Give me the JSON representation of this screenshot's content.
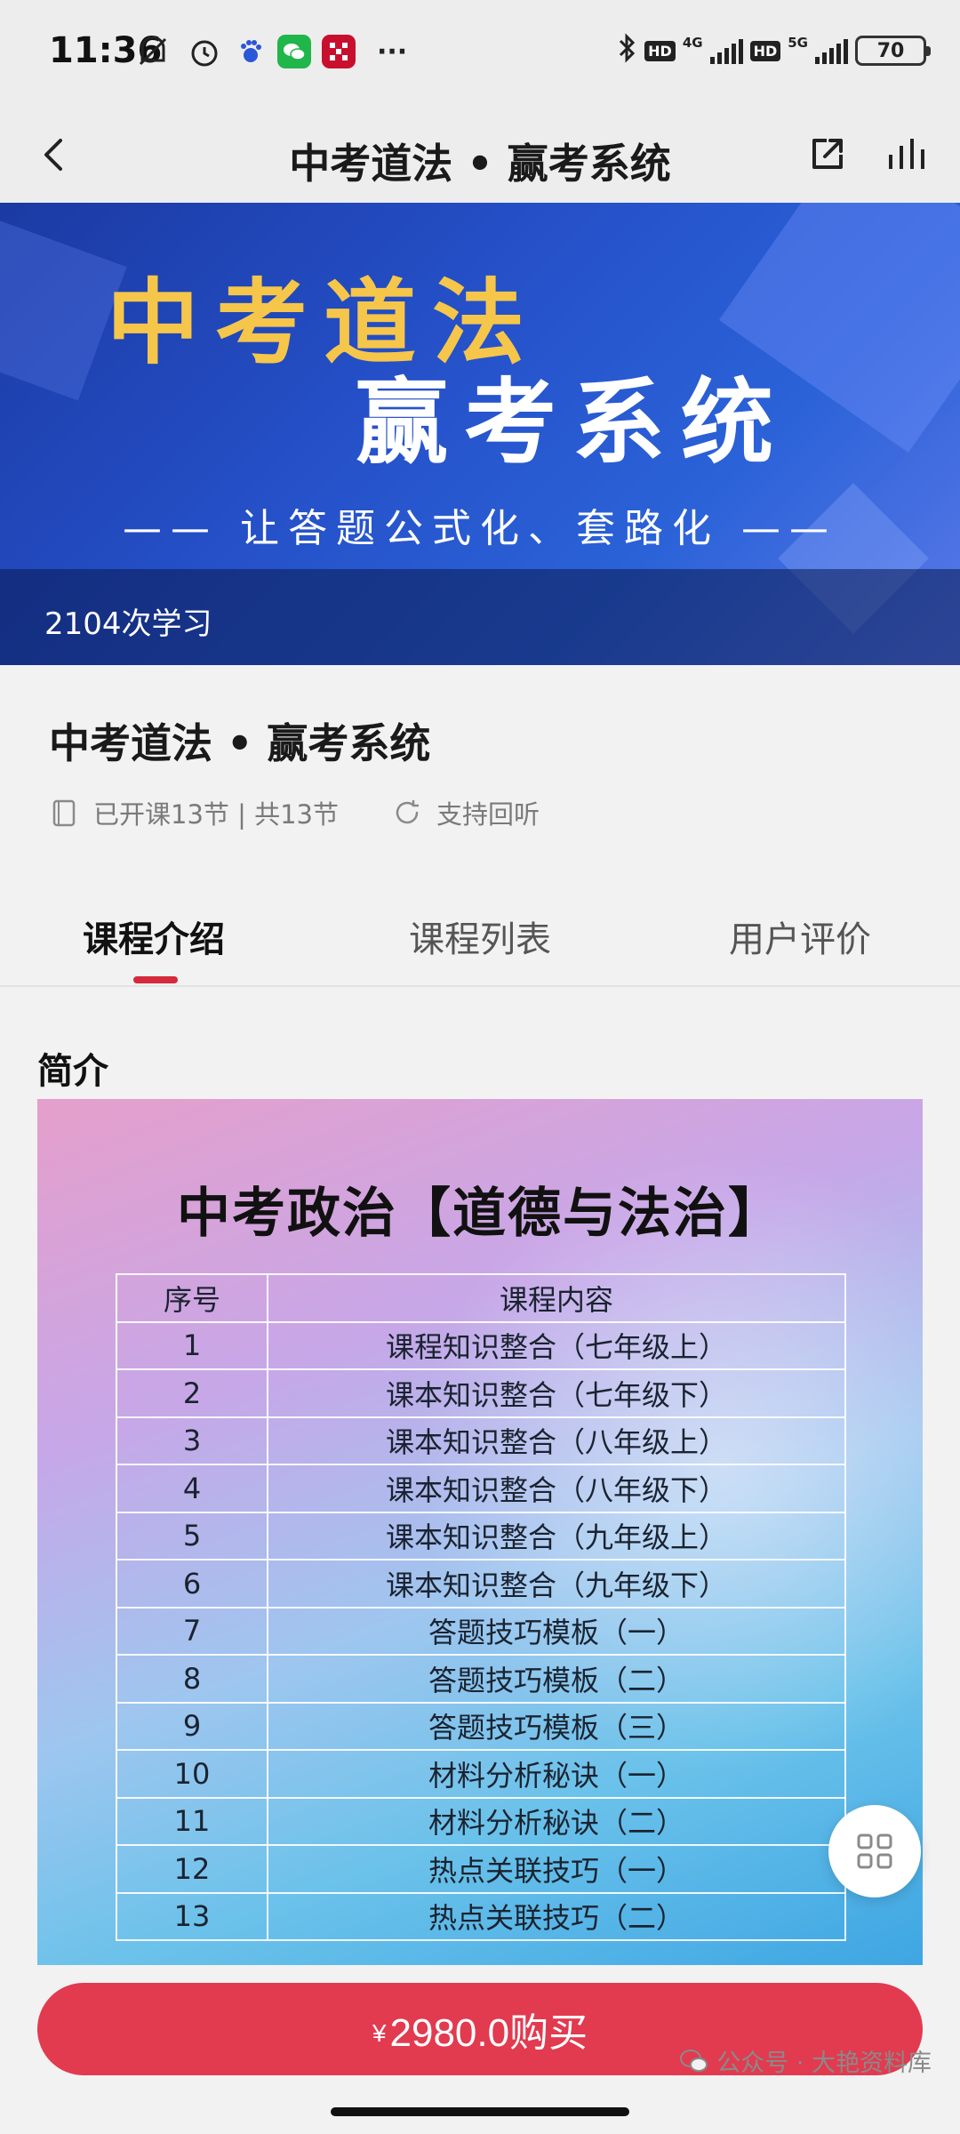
{
  "status_bar": {
    "time": "11:36",
    "battery": "70",
    "network_1": "4G",
    "network_2": "5G",
    "hd_label": "HD",
    "more": "···",
    "icons": [
      "mute-vibrate-icon",
      "alarm-icon",
      "baidu-icon",
      "wechat-icon",
      "app-icon",
      "bluetooth-icon"
    ]
  },
  "nav": {
    "title": "中考道法 • 赢考系统",
    "back_icon": "back-chevron-icon",
    "share_icon": "share-icon",
    "stats_icon": "stats-icon"
  },
  "banner": {
    "line1": "中考道法",
    "line2": "赢考系统",
    "slogan": "—— 让答题公式化、套路化 ——",
    "study_count": "2104次学习"
  },
  "course": {
    "title": "中考道法 • 赢考系统",
    "lessons": "已开课13节 | 共13节",
    "replay": "支持回听"
  },
  "tabs": [
    {
      "label": "课程介绍",
      "active": true
    },
    {
      "label": "课程列表",
      "active": false
    },
    {
      "label": "用户评价",
      "active": false
    }
  ],
  "intro": {
    "heading": "简介",
    "image_title": "中考政治【道德与法治】",
    "table_headers": [
      "序号",
      "课程内容"
    ],
    "rows": [
      [
        "1",
        "课程知识整合（七年级上）"
      ],
      [
        "2",
        "课本知识整合（七年级下）"
      ],
      [
        "3",
        "课本知识整合（八年级上）"
      ],
      [
        "4",
        "课本知识整合（八年级下）"
      ],
      [
        "5",
        "课本知识整合（九年级上）"
      ],
      [
        "6",
        "课本知识整合（九年级下）"
      ],
      [
        "7",
        "答题技巧模板（一）"
      ],
      [
        "8",
        "答题技巧模板（二）"
      ],
      [
        "9",
        "答题技巧模板（三）"
      ],
      [
        "10",
        "材料分析秘诀（一）"
      ],
      [
        "11",
        "材料分析秘诀（二）"
      ],
      [
        "12",
        "热点关联技巧（一）"
      ],
      [
        "13",
        "热点关联技巧（二）"
      ]
    ]
  },
  "buy": {
    "currency": "¥",
    "label": "2980.0购买"
  },
  "watermark": "公众号 · 大艳资料库",
  "colors": {
    "accent": "#e23a4f",
    "tab_indicator": "#d42a3c",
    "banner_blue": "#2550c8",
    "banner_gold": "#f5c64a"
  }
}
